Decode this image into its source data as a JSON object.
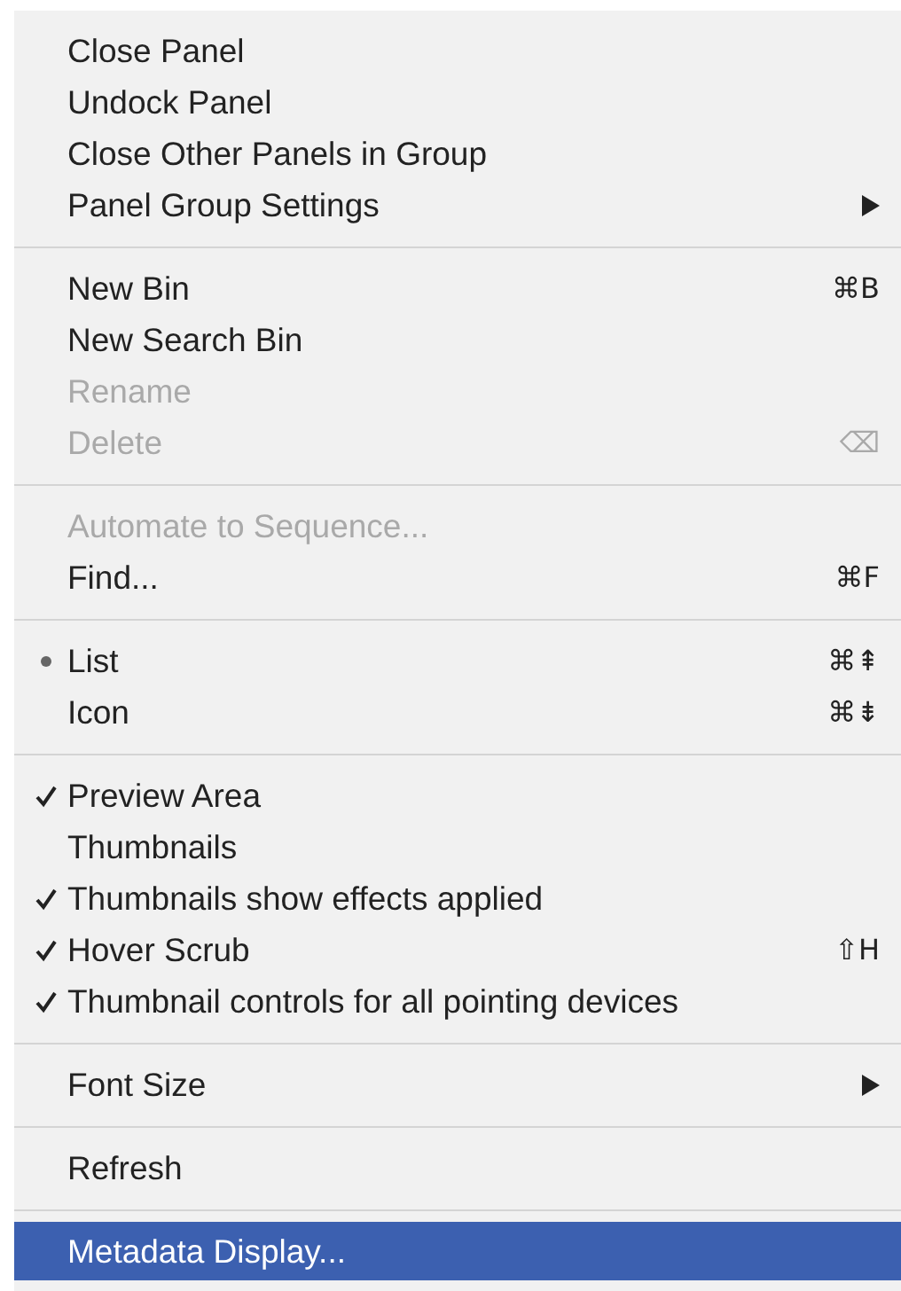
{
  "menu": {
    "groups": [
      {
        "items": [
          {
            "label": "Close Panel",
            "disabled": false
          },
          {
            "label": "Undock Panel",
            "disabled": false
          },
          {
            "label": "Close Other Panels in Group",
            "disabled": false
          },
          {
            "label": "Panel Group Settings",
            "disabled": false,
            "submenu": true
          }
        ]
      },
      {
        "items": [
          {
            "label": "New Bin",
            "disabled": false,
            "shortcut": "⌘B"
          },
          {
            "label": "New Search Bin",
            "disabled": false
          },
          {
            "label": "Rename",
            "disabled": true
          },
          {
            "label": "Delete",
            "disabled": true,
            "shortcut": "⌫"
          }
        ]
      },
      {
        "items": [
          {
            "label": "Automate to Sequence...",
            "disabled": true
          },
          {
            "label": "Find...",
            "disabled": false,
            "shortcut": "⌘F"
          }
        ]
      },
      {
        "items": [
          {
            "label": "List",
            "disabled": false,
            "selected": true,
            "shortcut": "⌘⇞"
          },
          {
            "label": "Icon",
            "disabled": false,
            "selected": false,
            "shortcut": "⌘⇟"
          }
        ]
      },
      {
        "items": [
          {
            "label": "Preview Area",
            "disabled": false,
            "checked": true
          },
          {
            "label": "Thumbnails",
            "disabled": false,
            "checked": false
          },
          {
            "label": "Thumbnails show effects applied",
            "disabled": false,
            "checked": true
          },
          {
            "label": "Hover Scrub",
            "disabled": false,
            "checked": true,
            "shortcut": "⇧H"
          },
          {
            "label": "Thumbnail controls for all pointing devices",
            "disabled": false,
            "checked": true
          }
        ]
      },
      {
        "items": [
          {
            "label": "Font Size",
            "disabled": false,
            "submenu": true
          }
        ]
      },
      {
        "items": [
          {
            "label": "Refresh",
            "disabled": false
          }
        ]
      },
      {
        "items": [
          {
            "label": "Metadata Display...",
            "disabled": false,
            "highlighted": true
          }
        ]
      }
    ]
  }
}
